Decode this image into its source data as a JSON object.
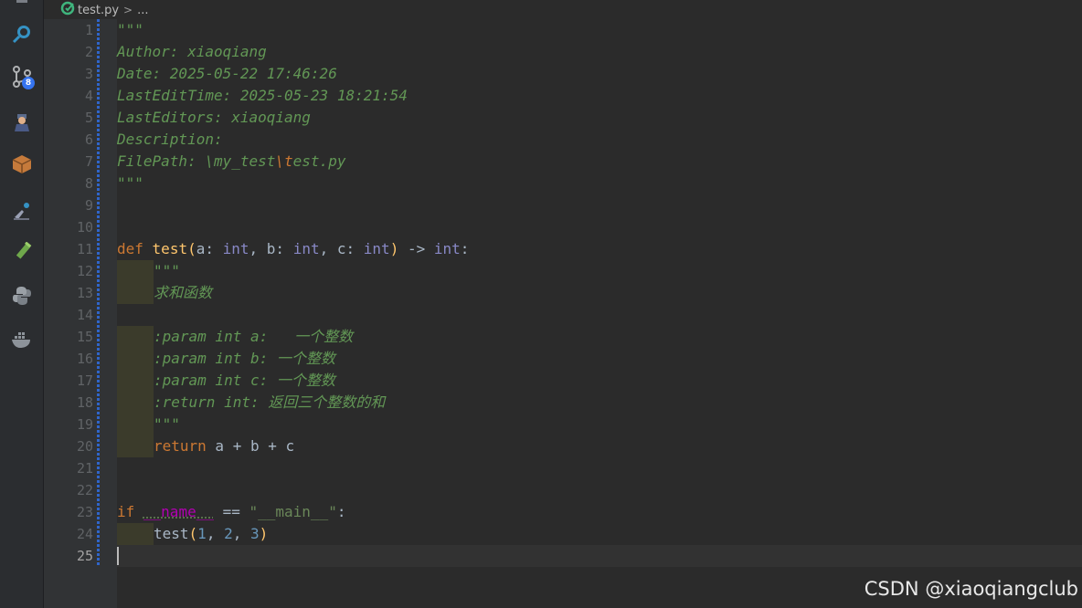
{
  "breadcrumb": {
    "file": "test.py",
    "separator": ">",
    "ellipsis": "..."
  },
  "activity_bar": {
    "icons": [
      "search-icon",
      "git-branch-icon",
      "user-icon",
      "package-icon",
      "deploy-icon",
      "test-icon",
      "python-icon",
      "docker-icon"
    ],
    "git_badge": "8"
  },
  "editor": {
    "line_numbers": [
      "1",
      "2",
      "3",
      "4",
      "5",
      "6",
      "7",
      "8",
      "9",
      "10",
      "11",
      "12",
      "13",
      "14",
      "15",
      "16",
      "17",
      "18",
      "19",
      "20",
      "21",
      "22",
      "23",
      "24",
      "25"
    ],
    "current_line": "25",
    "header_doc": {
      "quote": "\"\"\"",
      "author": "Author: xiaoqiang",
      "date": "Date: 2025-05-22 17:46:26",
      "last_edit": "LastEditTime: 2025-05-23 18:21:54",
      "last_editor": "LastEditors: xiaoqiang",
      "description": "Description:",
      "filepath_a": "FilePath: \\my_test",
      "filepath_b": "\\t",
      "filepath_c": "est.py"
    },
    "def_line": {
      "kw_def": "def",
      "name": "test",
      "open": "(",
      "p1": "a: ",
      "t1": "int",
      "p2": ", b: ",
      "t2": "int",
      "p3": ", c: ",
      "t3": "int",
      "close": ")",
      "arrow": " -> ",
      "rt": "int",
      "colon": ":"
    },
    "func_doc": {
      "quote": "\"\"\"",
      "summary": "求和函数",
      "param_a": ":param int a:   一个整数",
      "param_b": ":param int b: 一个整数",
      "param_c": ":param int c: 一个整数",
      "ret": ":return int: 返回三个整数的和"
    },
    "return_line": {
      "kw": "return",
      "expr": " a + b + c"
    },
    "main_line": {
      "kw": "if",
      "name": "__name__",
      "op": " == ",
      "str": "\"__main__\"",
      "colon": ":"
    },
    "call_line": {
      "name": "test",
      "open": "(",
      "a1": "1",
      "sep1": ", ",
      "a2": "2",
      "sep2": ", ",
      "a3": "3",
      "close": ")"
    }
  },
  "watermark": "CSDN @xiaoqiangclub",
  "colors": {
    "background": "#2b2b2b",
    "gutter": "#313335",
    "keyword": "#cc7832",
    "docstring": "#629755",
    "function": "#ffc66d",
    "builtin": "#8888c6",
    "number": "#6897bb",
    "string": "#6a8759",
    "magic": "#b200b2"
  }
}
